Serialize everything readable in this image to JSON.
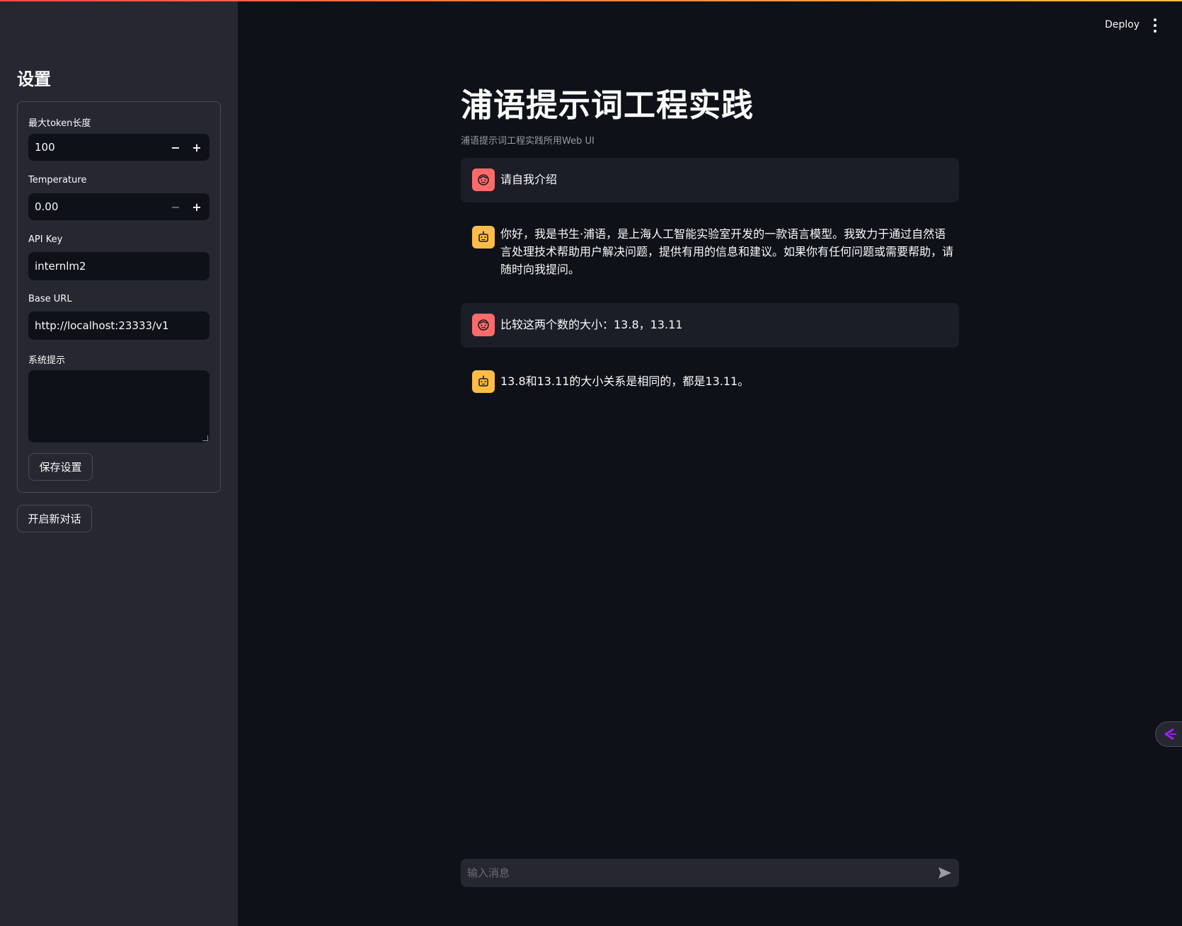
{
  "sidebar": {
    "title": "设置",
    "max_tokens": {
      "label": "最大token长度",
      "value": "100"
    },
    "temperature": {
      "label": "Temperature",
      "value": "0.00"
    },
    "api_key": {
      "label": "API Key",
      "value": "internlm2"
    },
    "base_url": {
      "label": "Base URL",
      "value": "http://localhost:23333/v1"
    },
    "system_prompt": {
      "label": "系统提示",
      "value": ""
    },
    "save_label": "保存设置",
    "new_chat_label": "开启新对话"
  },
  "header": {
    "deploy_label": "Deploy"
  },
  "main": {
    "title": "浦语提示词工程实践",
    "caption": "浦语提示词工程实践所用Web UI",
    "messages": [
      {
        "role": "user",
        "text": "请自我介绍"
      },
      {
        "role": "assistant",
        "text": "你好，我是书生·浦语，是上海人工智能实验室开发的一款语言模型。我致力于通过自然语言处理技术帮助用户解决问题，提供有用的信息和建议。如果你有任何问题或需要帮助，请随时向我提问。"
      },
      {
        "role": "user",
        "text": "比较这两个数的大小：13.8，13.11"
      },
      {
        "role": "assistant",
        "text": "13.8和13.11的大小关系是相同的，都是13.11。"
      }
    ],
    "chat_input_placeholder": "输入消息"
  },
  "colors": {
    "user_avatar": "#ff6b6b",
    "bot_avatar": "#ffbd45",
    "accent": "#ff4b4b"
  }
}
